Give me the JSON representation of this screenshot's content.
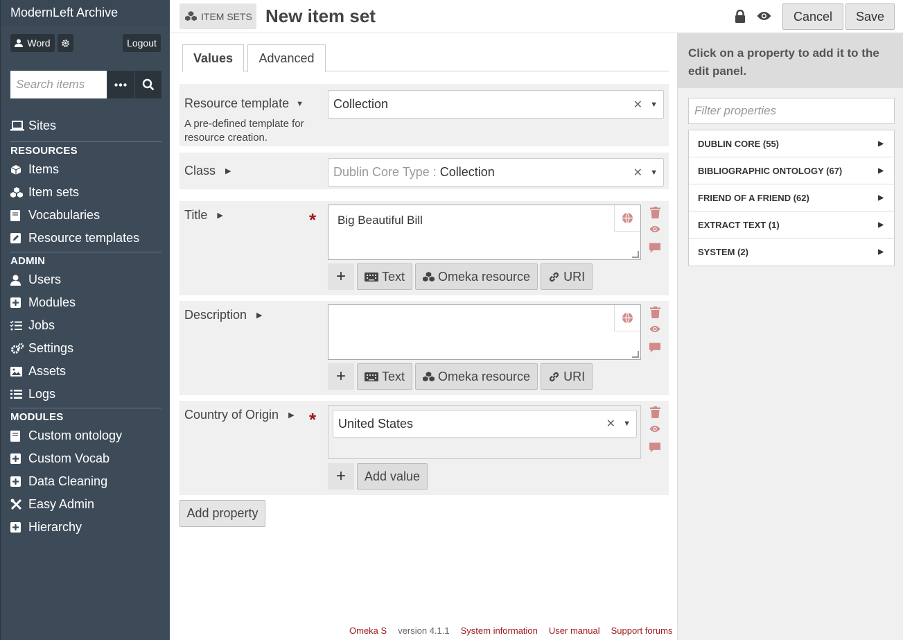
{
  "app": {
    "title": "ModernLeft Archive"
  },
  "user": {
    "name": "Word",
    "logout_label": "Logout"
  },
  "search": {
    "placeholder": "Search items"
  },
  "sidebar": {
    "sites": "Sites",
    "resources_heading": "RESOURCES",
    "resources": [
      "Items",
      "Item sets",
      "Vocabularies",
      "Resource templates"
    ],
    "admin_heading": "ADMIN",
    "admin": [
      "Users",
      "Modules",
      "Jobs",
      "Settings",
      "Assets",
      "Logs"
    ],
    "modules_heading": "MODULES",
    "modules": [
      "Custom ontology",
      "Custom Vocab",
      "Data Cleaning",
      "Easy Admin",
      "Hierarchy"
    ]
  },
  "header": {
    "section": "ITEM SETS",
    "title": "New item set",
    "cancel_label": "Cancel",
    "save_label": "Save"
  },
  "tabs": [
    "Values",
    "Advanced"
  ],
  "form": {
    "resource_template": {
      "label": "Resource template",
      "description": "A pre-defined template for resource creation.",
      "value": "Collection"
    },
    "class": {
      "label": "Class",
      "prefix": "Dublin Core Type :",
      "value": "Collection"
    },
    "title": {
      "label": "Title",
      "value": "Big Beautiful Bill"
    },
    "description": {
      "label": "Description",
      "value": ""
    },
    "country": {
      "label": "Country of Origin",
      "value": "United States",
      "add_value_label": "Add value"
    },
    "value_types": [
      "Text",
      "Omeka resource",
      "URI"
    ],
    "add_property_label": "Add property"
  },
  "right_panel": {
    "heading": "Click on a property to add it to the edit panel.",
    "filter_placeholder": "Filter properties",
    "vocabularies": [
      "DUBLIN CORE (55)",
      "BIBLIOGRAPHIC ONTOLOGY (67)",
      "FRIEND OF A FRIEND (62)",
      "EXTRACT TEXT (1)",
      "SYSTEM (2)"
    ]
  },
  "footer": {
    "brand": "Omeka S",
    "version": "version 4.1.1",
    "links": [
      "System information",
      "User manual",
      "Support forums"
    ]
  },
  "colors": {
    "sidebar": "#3d4b59",
    "danger": "#a0191d",
    "action_icon": "#d08a8a"
  }
}
